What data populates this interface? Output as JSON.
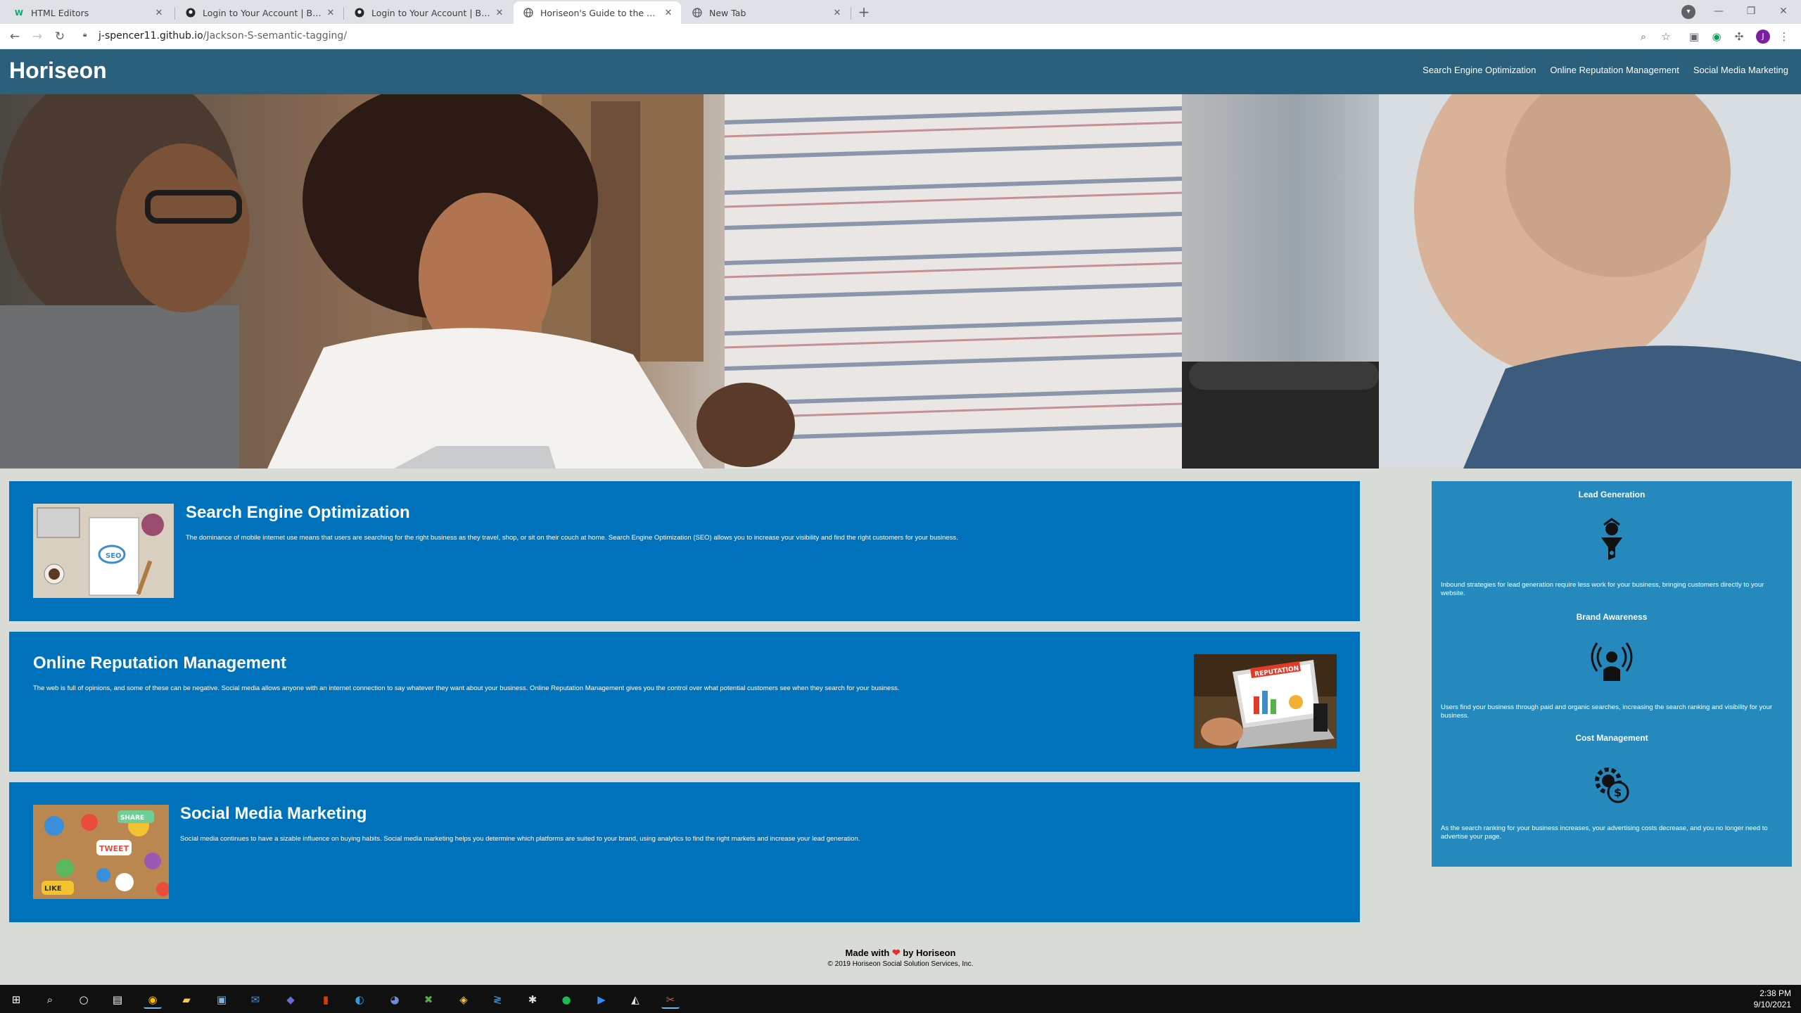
{
  "browser": {
    "tabs": [
      {
        "title": "HTML Editors",
        "favicon": "w3schools-icon",
        "active": false
      },
      {
        "title": "Login to Your Account | Bootcam",
        "favicon": "github-icon",
        "active": false
      },
      {
        "title": "Login to Your Account | Bootcam",
        "favicon": "github-icon",
        "active": false
      },
      {
        "title": "Horiseon's Guide to the Web",
        "favicon": "globe-icon",
        "active": true
      },
      {
        "title": "New Tab",
        "favicon": "globe-icon",
        "active": false
      }
    ],
    "url_domain": "j-spencer11.github.io",
    "url_path": "/Jackson-S-semantic-tagging/",
    "avatar_letter": "J"
  },
  "site": {
    "logo": "Horiseon",
    "nav": [
      "Search Engine Optimization",
      "Online Reputation Management",
      "Social Media Marketing"
    ],
    "sections": [
      {
        "title": "Search Engine Optimization",
        "text": "The dominance of mobile internet use means that users are searching for the right business as they travel, shop, or sit on their couch at home. Search Engine Optimization (SEO) allows you to increase your visibility and find the right customers for your business.",
        "image": "seo-image"
      },
      {
        "title": "Online Reputation Management",
        "text": "The web is full of opinions, and some of these can be negative. Social media allows anyone with an internet connection to say whatever they want about your business. Online Reputation Management gives you the control over what potential customers see when they search for your business.",
        "image": "reputation-image",
        "image_badge": "REPUTATION"
      },
      {
        "title": "Social Media Marketing",
        "text": "Social media continues to have a sizable influence on buying habits. Social media marketing helps you determine which platforms are suited to your brand, using analytics to find the right markets and increase your lead generation.",
        "image": "social-media-image",
        "image_words": [
          "SHARE",
          "TWEET",
          "LIKE"
        ]
      }
    ],
    "benefits": [
      {
        "title": "Lead Generation",
        "icon": "lead-generation-icon",
        "text": "Inbound strategies for lead generation require less work for your business, bringing customers directly to your website."
      },
      {
        "title": "Brand Awareness",
        "icon": "brand-awareness-icon",
        "text": "Users find your business through paid and organic searches, increasing the search ranking and visibility for your business."
      },
      {
        "title": "Cost Management",
        "icon": "cost-management-icon",
        "text": "As the search ranking for your business increases, your advertising costs decrease, and you no longer need to advertise your page."
      }
    ],
    "footer": {
      "made_prefix": "Made with",
      "made_suffix": "by Horiseon",
      "copyright": "© 2019 Horiseon Social Solution Services, Inc."
    }
  },
  "taskbar": {
    "time": "2:38 PM",
    "date": "9/10/2021"
  },
  "colors": {
    "header": "#2a607c",
    "card": "#0072bb",
    "benefits": "#2589bd",
    "page_bg": "#d9dcd6"
  }
}
